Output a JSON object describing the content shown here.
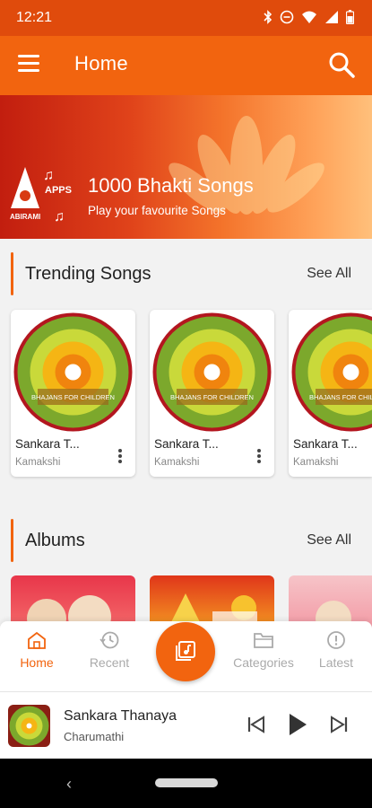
{
  "status_bar": {
    "time": "12:21"
  },
  "app_bar": {
    "title": "Home"
  },
  "banner": {
    "logo_text": {
      "apps": "APPS",
      "brand": "ABIRAMI"
    },
    "title": "1000 Bhakti Songs",
    "subtitle": "Play your favourite Songs"
  },
  "trending": {
    "title": "Trending Songs",
    "see_all": "See All",
    "cards": [
      {
        "title": "Sankara T...",
        "artist": "Kamakshi",
        "cover_text": "BHAJANS FOR CHILDREN"
      },
      {
        "title": "Sankara T...",
        "artist": "Kamakshi",
        "cover_text": "BHAJANS FOR CHILDREN"
      },
      {
        "title": "Sankara T...",
        "artist": "Kamakshi",
        "cover_text": "BHAJANS FOR CHILDREN"
      }
    ]
  },
  "albums": {
    "title": "Albums",
    "see_all": "See All"
  },
  "bottom_nav": {
    "items": [
      {
        "label": "Home",
        "active": true
      },
      {
        "label": "Recent",
        "active": false
      },
      {
        "label": "Categories",
        "active": false
      },
      {
        "label": "Latest",
        "active": false
      }
    ]
  },
  "player": {
    "title": "Sankara Thanaya",
    "artist": "Charumathi"
  },
  "colors": {
    "primary": "#f2640f",
    "status_bar": "#e04b0c"
  }
}
